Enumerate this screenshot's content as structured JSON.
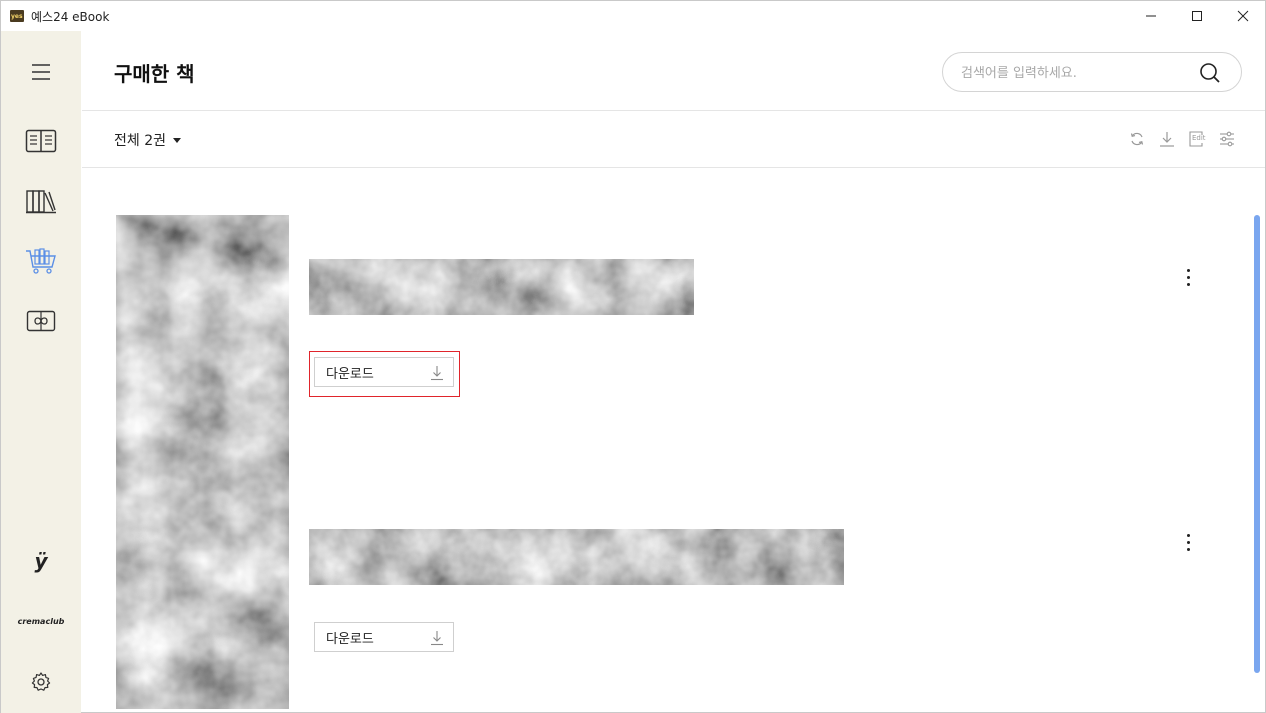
{
  "window": {
    "title": "예스24 eBook"
  },
  "sidebar": {
    "items": [
      {
        "name": "menu",
        "icon": "hamburger-icon"
      },
      {
        "name": "reading",
        "icon": "open-book-icon"
      },
      {
        "name": "library",
        "icon": "bookshelf-icon"
      },
      {
        "name": "purchased",
        "icon": "shopping-cart-icon",
        "active_color": "#5b8fe6"
      },
      {
        "name": "unlimited",
        "icon": "infinity-book-icon"
      },
      {
        "name": "yes24",
        "label": "ÿ"
      },
      {
        "name": "crema",
        "label": "cremaclub"
      },
      {
        "name": "settings",
        "icon": "gear-icon"
      }
    ]
  },
  "header": {
    "title": "구매한 책",
    "search_placeholder": "검색어를 입력하세요."
  },
  "filter": {
    "label": "전체 2권",
    "tools": [
      "refresh-icon",
      "download-icon",
      "edit-icon",
      "settings-sliders-icon"
    ],
    "edit_label": "Edit"
  },
  "books": [
    {
      "download_label": "다운로드",
      "highlighted": true
    },
    {
      "download_label": "다운로드",
      "highlighted": false
    }
  ],
  "colors": {
    "sidebar_bg": "#f3f1e6",
    "accent": "#5b8fe6",
    "highlight": "#e0242b",
    "scrollbar": "#7aa6ef"
  }
}
